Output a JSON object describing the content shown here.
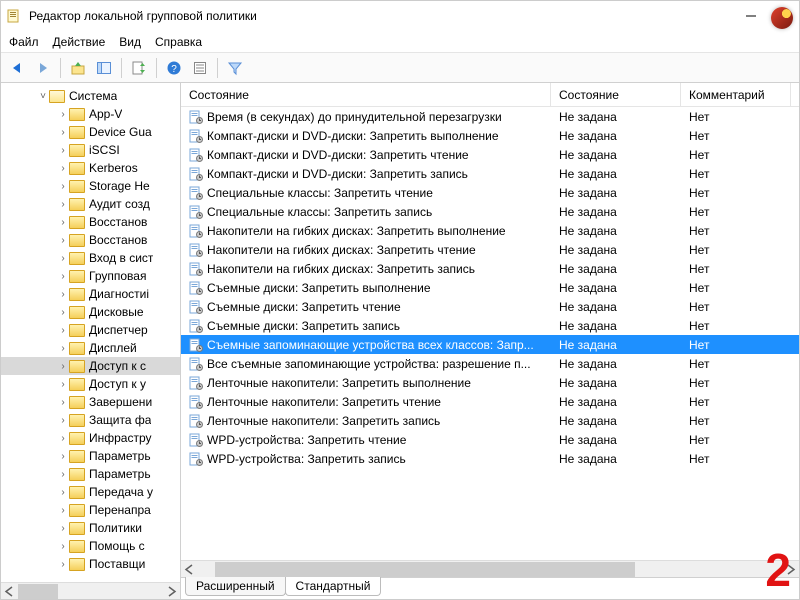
{
  "title": "Редактор локальной групповой политики",
  "menu": {
    "file": "Файл",
    "action": "Действие",
    "view": "Вид",
    "help": "Справка"
  },
  "tree": {
    "root": {
      "label": "Система",
      "open": true
    },
    "items": [
      "App-V",
      "Device Gua",
      "iSCSI",
      "Kerberos",
      "Storage He",
      "Аудит созд",
      "Восстанов",
      "Восстанов",
      "Вход в сист",
      "Групповая",
      "Диагностиі",
      "Дисковые",
      "Диспетчер",
      "Дисплей",
      "Доступ к с",
      "Доступ к у",
      "Завершени",
      "Защита фа",
      "Инфрастру",
      "Параметрь",
      "Параметрь",
      "Передача у",
      "Перенапра",
      "Политики",
      "Помощь с",
      "Поставщи"
    ],
    "selected_index": 14
  },
  "columns": {
    "name": "Состояние",
    "state": "Состояние",
    "comment": "Комментарий"
  },
  "rows": [
    {
      "name": "Время (в секундах) до принудительной перезагрузки",
      "state": "Не задана",
      "comment": "Нет"
    },
    {
      "name": "Компакт-диски и DVD-диски: Запретить выполнение",
      "state": "Не задана",
      "comment": "Нет"
    },
    {
      "name": "Компакт-диски и DVD-диски: Запретить чтение",
      "state": "Не задана",
      "comment": "Нет"
    },
    {
      "name": "Компакт-диски и DVD-диски: Запретить запись",
      "state": "Не задана",
      "comment": "Нет"
    },
    {
      "name": "Специальные классы: Запретить чтение",
      "state": "Не задана",
      "comment": "Нет"
    },
    {
      "name": "Специальные классы: Запретить запись",
      "state": "Не задана",
      "comment": "Нет"
    },
    {
      "name": "Накопители на гибких дисках: Запретить выполнение",
      "state": "Не задана",
      "comment": "Нет"
    },
    {
      "name": "Накопители на гибких дисках: Запретить чтение",
      "state": "Не задана",
      "comment": "Нет"
    },
    {
      "name": "Накопители на гибких дисках: Запретить запись",
      "state": "Не задана",
      "comment": "Нет"
    },
    {
      "name": "Съемные диски: Запретить выполнение",
      "state": "Не задана",
      "comment": "Нет"
    },
    {
      "name": "Съемные диски: Запретить чтение",
      "state": "Не задана",
      "comment": "Нет"
    },
    {
      "name": "Съемные диски: Запретить запись",
      "state": "Не задана",
      "comment": "Нет"
    },
    {
      "name": "Съемные запоминающие устройства всех классов: Запр...",
      "state": "Не задана",
      "comment": "Нет",
      "selected": true
    },
    {
      "name": "Все съемные запоминающие устройства: разрешение п...",
      "state": "Не задана",
      "comment": "Нет"
    },
    {
      "name": "Ленточные накопители: Запретить выполнение",
      "state": "Не задана",
      "comment": "Нет"
    },
    {
      "name": "Ленточные накопители: Запретить чтение",
      "state": "Не задана",
      "comment": "Нет"
    },
    {
      "name": "Ленточные накопители: Запретить запись",
      "state": "Не задана",
      "comment": "Нет"
    },
    {
      "name": "WPD-устройства: Запретить чтение",
      "state": "Не задана",
      "comment": "Нет"
    },
    {
      "name": "WPD-устройства: Запретить запись",
      "state": "Не задана",
      "comment": "Нет"
    }
  ],
  "bottom_tabs": {
    "extended": "Расширенный",
    "standard": "Стандартный"
  },
  "step_number": "2",
  "col_widths": {
    "name": 370,
    "state": 130,
    "comment": 110
  }
}
